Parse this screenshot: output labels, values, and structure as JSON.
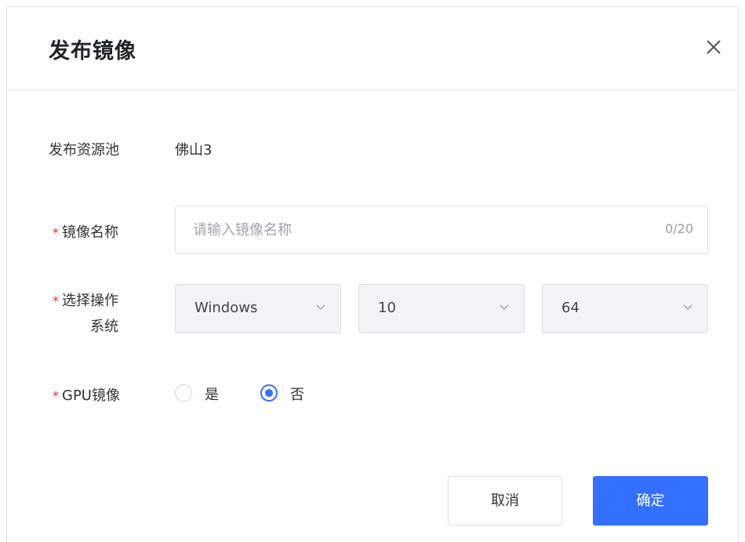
{
  "dialog": {
    "title": "发布镜像",
    "close_icon": "close-icon"
  },
  "form": {
    "pool": {
      "label": "发布资源池",
      "value": "佛山3"
    },
    "image_name": {
      "required_mark": "*",
      "label": "镜像名称",
      "value": "",
      "placeholder": "请输入镜像名称",
      "counter": "0/20"
    },
    "os": {
      "required_mark": "*",
      "label_line1": "选择操作",
      "label_line2": "系统",
      "type_value": "Windows",
      "version_value": "10",
      "bits_value": "64",
      "chevron_icon": "chevron-down-icon"
    },
    "gpu": {
      "required_mark": "*",
      "label": "GPU镜像",
      "options": [
        {
          "label": "是",
          "checked": false
        },
        {
          "label": "否",
          "checked": true
        }
      ]
    }
  },
  "footer": {
    "cancel_label": "取消",
    "ok_label": "确定"
  },
  "colors": {
    "primary": "#3370ff",
    "required": "#f5222d",
    "select_bg": "#f2f3f5"
  }
}
